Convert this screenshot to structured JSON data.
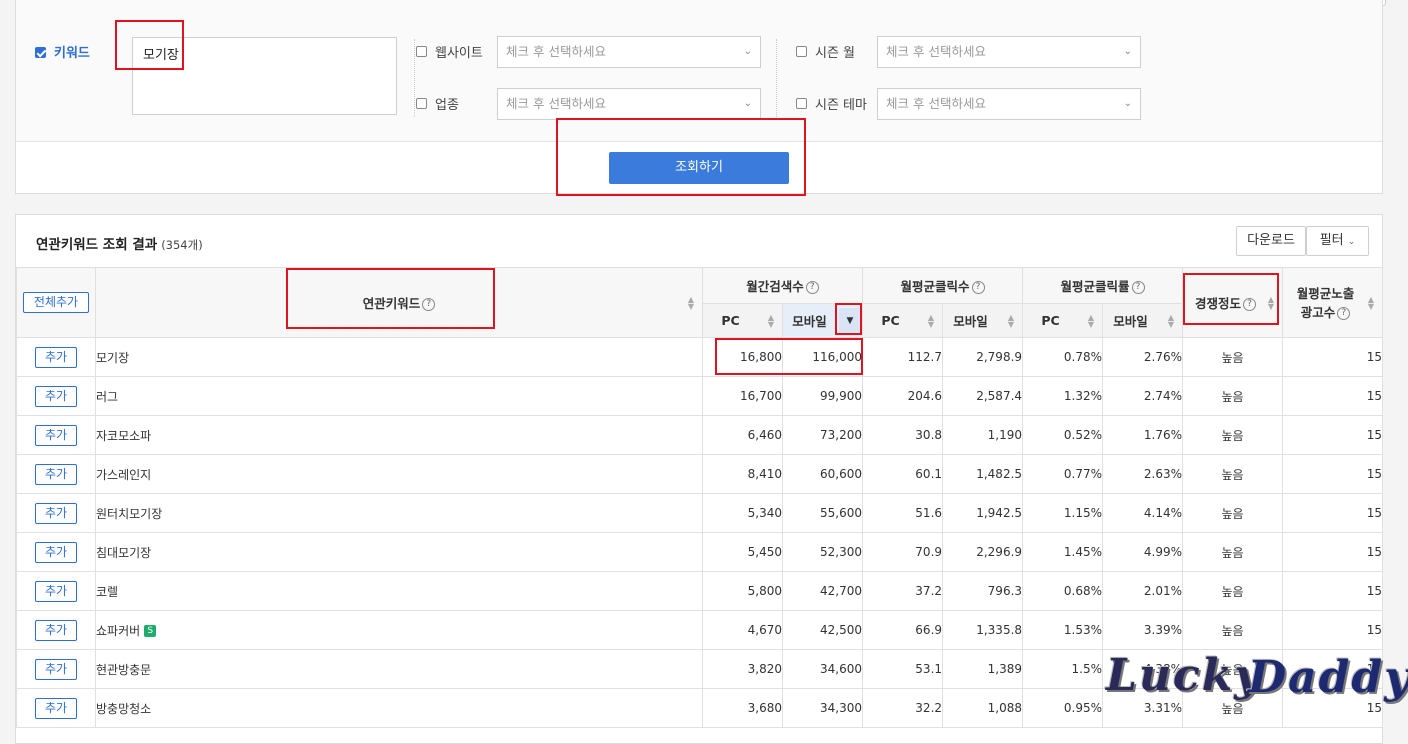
{
  "search": {
    "keyword_label": "키워드",
    "keyword_value": "모기장",
    "website_label": "웹사이트",
    "industry_label": "업종",
    "season_month_label": "시즌 월",
    "season_theme_label": "시즌 테마",
    "select_placeholder": "체크 후 선택하세요",
    "submit_label": "조회하기"
  },
  "results": {
    "title": "연관키워드 조회 결과",
    "count": "(354개)",
    "download_label": "다운로드",
    "filter_label": "필터",
    "headers": {
      "add_all": "전체추가",
      "keyword": "연관키워드",
      "monthly_search": "월간검색수",
      "avg_clicks": "월평균클릭수",
      "avg_ctr": "월평균클릭률",
      "competition": "경쟁정도",
      "ad_count_line1": "월평균노출",
      "ad_count_line2": "광고수",
      "pc": "PC",
      "mobile": "모바일"
    },
    "add_label": "추가",
    "rows": [
      {
        "keyword": "모기장",
        "pc_search": "16,800",
        "mo_search": "116,000",
        "pc_clicks": "112.7",
        "mo_clicks": "2,798.9",
        "pc_ctr": "0.78%",
        "mo_ctr": "2.76%",
        "competition": "높음",
        "ads": "15"
      },
      {
        "keyword": "러그",
        "pc_search": "16,700",
        "mo_search": "99,900",
        "pc_clicks": "204.6",
        "mo_clicks": "2,587.4",
        "pc_ctr": "1.32%",
        "mo_ctr": "2.74%",
        "competition": "높음",
        "ads": "15"
      },
      {
        "keyword": "자코모소파",
        "pc_search": "6,460",
        "mo_search": "73,200",
        "pc_clicks": "30.8",
        "mo_clicks": "1,190",
        "pc_ctr": "0.52%",
        "mo_ctr": "1.76%",
        "competition": "높음",
        "ads": "15"
      },
      {
        "keyword": "가스레인지",
        "pc_search": "8,410",
        "mo_search": "60,600",
        "pc_clicks": "60.1",
        "mo_clicks": "1,482.5",
        "pc_ctr": "0.77%",
        "mo_ctr": "2.63%",
        "competition": "높음",
        "ads": "15"
      },
      {
        "keyword": "원터치모기장",
        "pc_search": "5,340",
        "mo_search": "55,600",
        "pc_clicks": "51.6",
        "mo_clicks": "1,942.5",
        "pc_ctr": "1.15%",
        "mo_ctr": "4.14%",
        "competition": "높음",
        "ads": "15"
      },
      {
        "keyword": "침대모기장",
        "pc_search": "5,450",
        "mo_search": "52,300",
        "pc_clicks": "70.9",
        "mo_clicks": "2,296.9",
        "pc_ctr": "1.45%",
        "mo_ctr": "4.99%",
        "competition": "높음",
        "ads": "15"
      },
      {
        "keyword": "코렐",
        "pc_search": "5,800",
        "mo_search": "42,700",
        "pc_clicks": "37.2",
        "mo_clicks": "796.3",
        "pc_ctr": "0.68%",
        "mo_ctr": "2.01%",
        "competition": "높음",
        "ads": "15"
      },
      {
        "keyword": "쇼파커버",
        "badge": "S",
        "pc_search": "4,670",
        "mo_search": "42,500",
        "pc_clicks": "66.9",
        "mo_clicks": "1,335.8",
        "pc_ctr": "1.53%",
        "mo_ctr": "3.39%",
        "competition": "높음",
        "ads": "15"
      },
      {
        "keyword": "현관방충문",
        "pc_search": "3,820",
        "mo_search": "34,600",
        "pc_clicks": "53.1",
        "mo_clicks": "1,389",
        "pc_ctr": "1.5%",
        "mo_ctr": "4.38%",
        "competition": "높음",
        "ads": "15"
      },
      {
        "keyword": "방충망청소",
        "pc_search": "3,680",
        "mo_search": "34,300",
        "pc_clicks": "32.2",
        "mo_clicks": "1,088",
        "pc_ctr": "0.95%",
        "mo_ctr": "3.31%",
        "competition": "높음",
        "ads": "15"
      }
    ]
  },
  "watermark": {
    "word1": "Lucky",
    "word2": "Daddy"
  },
  "colors": {
    "accent": "#3b7bdb",
    "highlight": "#e0141e",
    "badge": "#1faa6e"
  }
}
